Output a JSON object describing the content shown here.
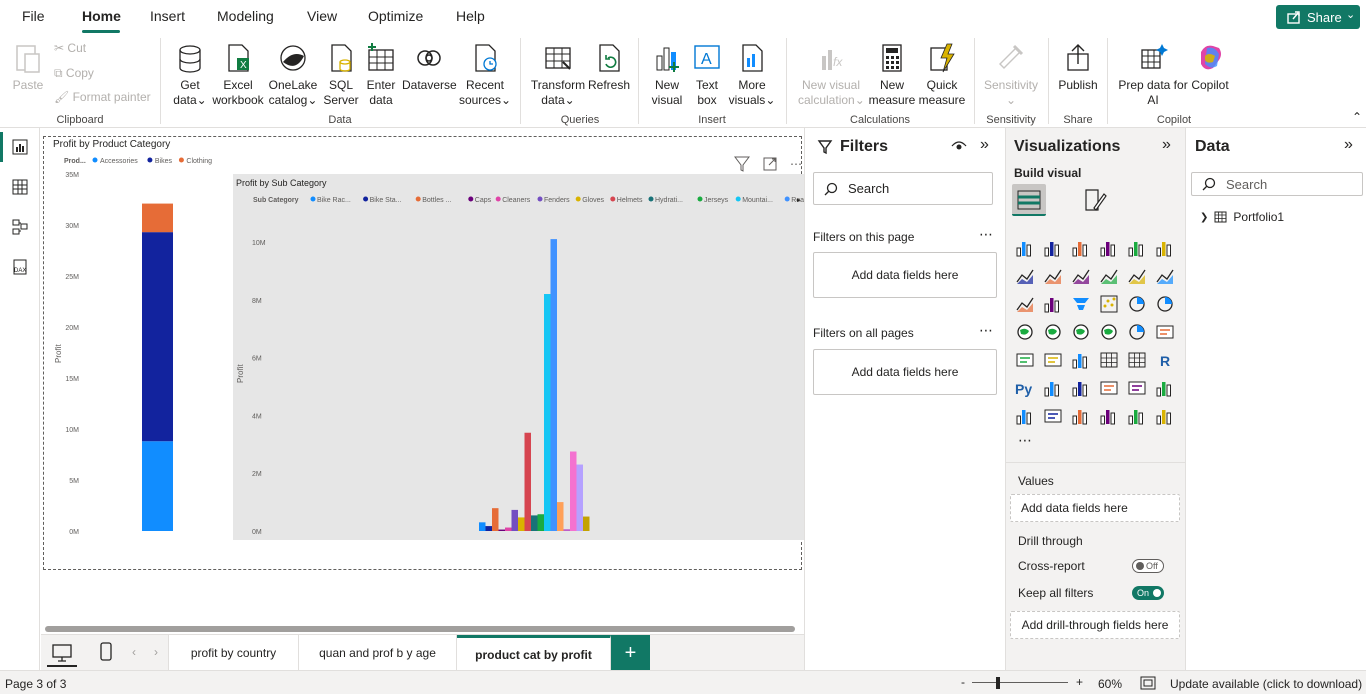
{
  "menu": {
    "items": [
      "File",
      "Home",
      "Insert",
      "Modeling",
      "View",
      "Optimize",
      "Help"
    ],
    "share_label": "Share"
  },
  "ribbon": {
    "clipboard": {
      "paste": "Paste",
      "cut": "Cut",
      "copy": "Copy",
      "format_painter": "Format painter",
      "label": "Clipboard"
    },
    "data": {
      "get_data": [
        "Get",
        "data"
      ],
      "excel": [
        "Excel",
        "workbook"
      ],
      "onelake": [
        "OneLake",
        "catalog"
      ],
      "sql": [
        "SQL",
        "Server"
      ],
      "enter": [
        "Enter",
        "data"
      ],
      "dataverse": "Dataverse",
      "recent": [
        "Recent",
        "sources"
      ],
      "label": "Data"
    },
    "queries": {
      "transform": [
        "Transform",
        "data"
      ],
      "refresh": "Refresh",
      "label": "Queries"
    },
    "insert": {
      "new_visual": [
        "New",
        "visual"
      ],
      "text_box": [
        "Text",
        "box"
      ],
      "more_visuals": [
        "More",
        "visuals"
      ],
      "label": "Insert"
    },
    "calculations": {
      "new_visual_calc": [
        "New visual",
        "calculation"
      ],
      "new_measure": [
        "New",
        "measure"
      ],
      "quick_measure": [
        "Quick",
        "measure"
      ],
      "label": "Calculations"
    },
    "sensitivity": {
      "btn": "Sensitivity",
      "label": "Sensitivity"
    },
    "share": {
      "publish": "Publish",
      "label": "Share"
    },
    "copilot": {
      "prep": [
        "Prep data for",
        "AI"
      ],
      "copilot": "Copilot",
      "label": "Copilot"
    }
  },
  "charts": {
    "left": {
      "title": "Profit by Product Category",
      "legend_title": "Prod...",
      "ylabel": "Profit",
      "ticks": [
        "35M",
        "30M",
        "25M",
        "20M",
        "15M",
        "10M",
        "5M",
        "0M"
      ]
    },
    "right": {
      "title": "Profit by Sub Category",
      "legend_title": "Sub Category",
      "ylabel": "Profit",
      "ticks": [
        "10M",
        "8M",
        "6M",
        "4M",
        "2M",
        "0M"
      ]
    }
  },
  "chart_data": [
    {
      "type": "bar",
      "title": "Profit by Product Category",
      "ylabel": "Profit",
      "ylim": [
        0,
        35000000
      ],
      "stacked": true,
      "series": [
        {
          "name": "Accessories",
          "values": [
            8800000
          ],
          "color": "#118DFF"
        },
        {
          "name": "Bikes",
          "values": [
            20500000
          ],
          "color": "#12239E"
        },
        {
          "name": "Clothing",
          "values": [
            2800000
          ],
          "color": "#E66C37"
        }
      ],
      "legend": "top-left"
    },
    {
      "type": "bar",
      "title": "Profit by Sub Category",
      "ylabel": "Profit",
      "ylim": [
        0,
        10600000
      ],
      "legend": "top-left",
      "series": [
        {
          "name": "Bike Rac...",
          "values": [
            300000
          ],
          "color": "#118DFF"
        },
        {
          "name": "Bike Sta...",
          "values": [
            170000
          ],
          "color": "#12239E"
        },
        {
          "name": "Bottles ...",
          "values": [
            790000
          ],
          "color": "#E66C37"
        },
        {
          "name": "Caps",
          "values": [
            50000
          ],
          "color": "#6B007B"
        },
        {
          "name": "Cleaners",
          "values": [
            120000
          ],
          "color": "#E044A7"
        },
        {
          "name": "Fenders",
          "values": [
            730000
          ],
          "color": "#744EC2"
        },
        {
          "name": "Gloves",
          "values": [
            470000
          ],
          "color": "#D9B300"
        },
        {
          "name": "Helmets",
          "values": [
            3400000
          ],
          "color": "#D64550"
        },
        {
          "name": "Hydrati...",
          "values": [
            540000
          ],
          "color": "#197278"
        },
        {
          "name": "Jerseys",
          "values": [
            580000
          ],
          "color": "#1AAB40"
        },
        {
          "name": "Mountai...",
          "values": [
            8200000
          ],
          "color": "#15C6F4"
        },
        {
          "name": "Road Bi...",
          "values": [
            10100000
          ],
          "color": "#4092FF"
        },
        {
          "name": "",
          "values": [
            1000000
          ],
          "color": "#FFA058"
        },
        {
          "name": "",
          "values": [
            60000
          ],
          "color": "#BE5DC9"
        },
        {
          "name": "",
          "values": [
            2750000
          ],
          "color": "#F472D0"
        },
        {
          "name": "",
          "values": [
            2300000
          ],
          "color": "#B5A1FF"
        },
        {
          "name": "",
          "values": [
            500000
          ],
          "color": "#C4A200"
        }
      ]
    }
  ],
  "filters": {
    "title": "Filters",
    "on_page": "Filters on this page",
    "on_all": "Filters on all pages",
    "add": "Add data fields here",
    "search_placeholder": "Search"
  },
  "visualizations": {
    "title": "Visualizations",
    "build_visual": "Build visual",
    "values": "Values",
    "add_fields": "Add data fields here",
    "drill_through": "Drill through",
    "cross_report": "Cross-report",
    "cross_state": "Off",
    "keep_filters": "Keep all filters",
    "keep_state": "On",
    "add_drill": "Add drill-through fields here"
  },
  "data_pane": {
    "title": "Data",
    "search_placeholder": "Search",
    "tables": [
      "Portfolio1"
    ]
  },
  "tabs": [
    "profit by country",
    "quan and prof b y age",
    "product cat by profit"
  ],
  "active_tab": 2,
  "status": {
    "page": "Page 3 of 3",
    "zoom": "60%",
    "update": "Update available (click to download)"
  },
  "colors": {
    "accent": "#117865",
    "plot_bg": "#E6E6E6"
  }
}
